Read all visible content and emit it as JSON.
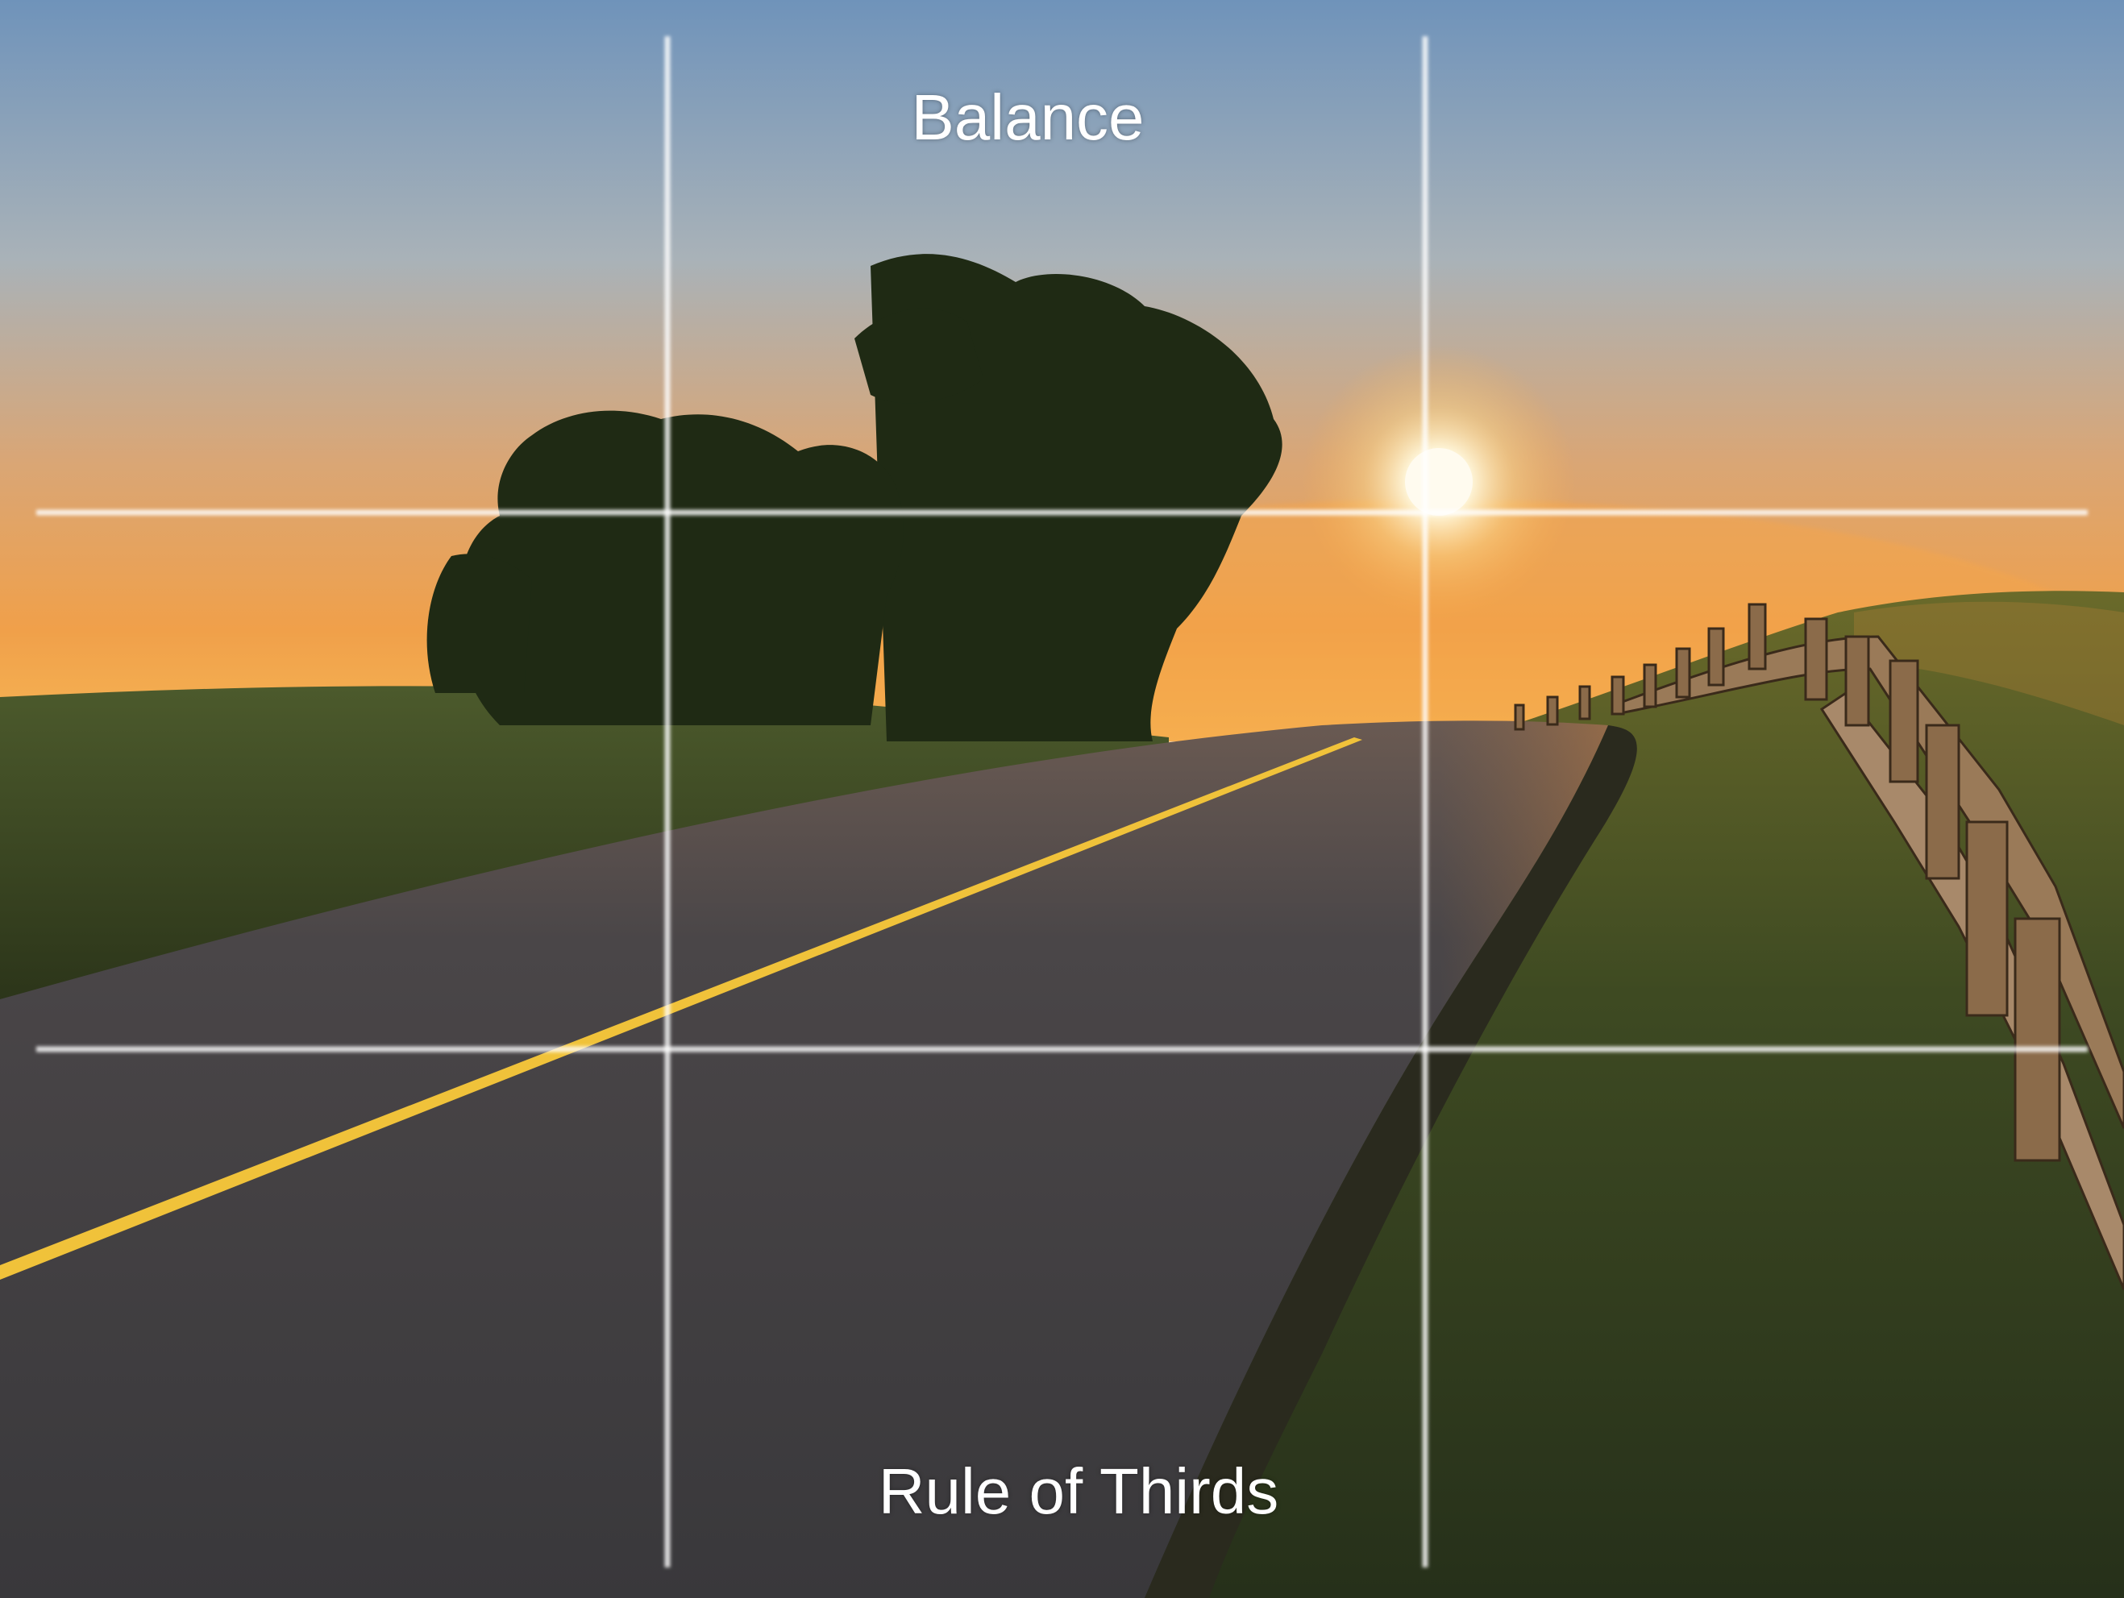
{
  "labels": {
    "top": "Balance",
    "bottom": "Rule of Thirds"
  },
  "colors": {
    "sky_top": "#7a9cc0",
    "sky_mid": "#c8b09a",
    "sky_horizon": "#f2a24a",
    "sun": "#fff6dc",
    "road": "#3e3c3e",
    "center_line": "#f0c23a",
    "grass": "#3d4a22",
    "grid_line": "#ffffff"
  },
  "icons": {
    "sun": "sun-glow",
    "trees": "tree-silhouette",
    "fence": "wooden-fence"
  }
}
